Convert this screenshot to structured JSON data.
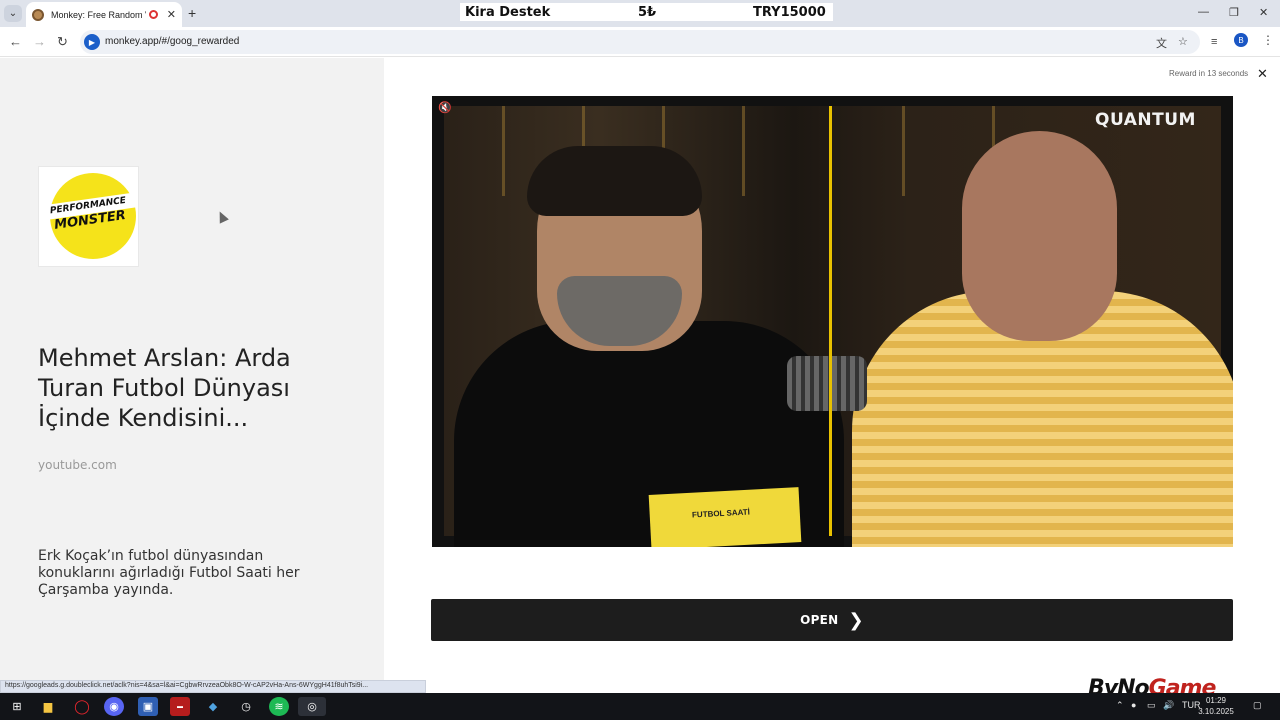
{
  "browser": {
    "tab_title": "Monkey: Free Random Video",
    "new_tab": "+",
    "url": "monkey.app/#/goog_rewarded",
    "profile_initial": "B",
    "status_url": "https://googleads.g.doubleclick.net/aclk?nis=4&sa=l&ai=CgbwRrvzeaObk8O-W-cAP2vHa-Ans-6WYggH41f8uhTsi9i..."
  },
  "overlay": {
    "label": "Kira Destek",
    "amount": "5₺",
    "goal": "TRY15000"
  },
  "ad": {
    "logo_line1": "PERFORMANCE",
    "logo_line2": "MONSTER",
    "title": "Mehmet Arslan: Arda Turan Futbol Dünyası İçinde Kendisini...",
    "domain": "youtube.com",
    "description": "Erk Koçak’ın futbol dünyasından konuklarını ağırladığı Futbol Saati her Çarşamba yayında.",
    "reward_text": "Reward in 13 seconds",
    "video_brand": "QUANTUM",
    "card_text": "FUTBOL SAATİ",
    "open_label": "OPEN"
  },
  "watermark": {
    "part1": "ByNo",
    "part2": "Game"
  },
  "taskbar": {
    "lang": "TUR",
    "time": "01:29",
    "date": "3.10.2025"
  },
  "colors": {
    "logo_yellow": "#f5e31a",
    "open_button": "#1d1d1d",
    "video_divider": "#e9c200"
  },
  "icons": [
    "tab-search-icon",
    "back-arrow-icon",
    "forward-arrow-icon",
    "reload-icon",
    "translate-icon",
    "star-icon",
    "media-control-icon",
    "mute-icon",
    "close-icon",
    "chevron-right-icon",
    "windows-start-icon"
  ]
}
